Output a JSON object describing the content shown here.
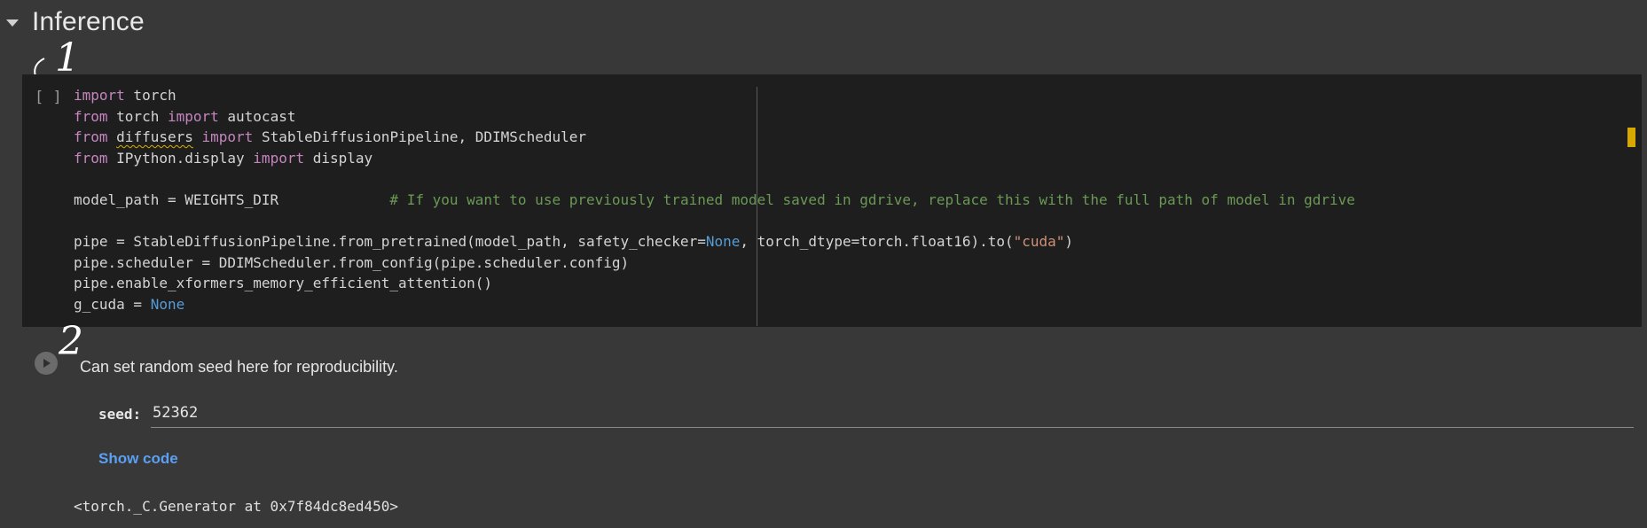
{
  "section": {
    "title": "Inference"
  },
  "code_cell": {
    "run_indicator": "[ ]",
    "lines": [
      [
        {
          "t": "import",
          "c": "kw"
        },
        {
          "t": " torch",
          "c": ""
        }
      ],
      [
        {
          "t": "from",
          "c": "kw"
        },
        {
          "t": " torch ",
          "c": ""
        },
        {
          "t": "import",
          "c": "kw"
        },
        {
          "t": " autocast",
          "c": ""
        }
      ],
      [
        {
          "t": "from",
          "c": "kw"
        },
        {
          "t": " ",
          "c": ""
        },
        {
          "t": "diffusers",
          "c": "squiggle"
        },
        {
          "t": " ",
          "c": ""
        },
        {
          "t": "import",
          "c": "kw"
        },
        {
          "t": " StableDiffusionPipeline, DDIMScheduler",
          "c": ""
        }
      ],
      [
        {
          "t": "from",
          "c": "kw"
        },
        {
          "t": " IPython.display ",
          "c": ""
        },
        {
          "t": "import",
          "c": "kw"
        },
        {
          "t": " display",
          "c": ""
        }
      ],
      [],
      [
        {
          "t": "model_path = WEIGHTS_DIR             ",
          "c": ""
        },
        {
          "t": "# If you want to use previously trained model saved in gdrive, replace this with the full path of model in gdrive",
          "c": "cmt"
        }
      ],
      [],
      [
        {
          "t": "pipe = StableDiffusionPipeline.from_pretrained(model_path, safety_checker=",
          "c": ""
        },
        {
          "t": "None",
          "c": "none"
        },
        {
          "t": ", torch_dtype=torch.float16).to(",
          "c": ""
        },
        {
          "t": "\"cuda\"",
          "c": "str"
        },
        {
          "t": ")",
          "c": ""
        }
      ],
      [
        {
          "t": "pipe.scheduler = DDIMScheduler.from_config(pipe.scheduler.config)",
          "c": ""
        }
      ],
      [
        {
          "t": "pipe.enable_xformers_memory_efficient_attention()",
          "c": ""
        }
      ],
      [
        {
          "t": "g_cuda = ",
          "c": ""
        },
        {
          "t": "None",
          "c": "none"
        }
      ]
    ]
  },
  "annotations": {
    "one": "1",
    "two": "2"
  },
  "form_cell": {
    "description": "Can set random seed here for reproducibility.",
    "seed_label": "seed:",
    "seed_value": "52362",
    "show_code": "Show code",
    "output": "<torch._C.Generator at 0x7f84dc8ed450>"
  },
  "colors": {
    "keyword": "#c586c0",
    "none": "#569cd6",
    "string": "#ce9178",
    "comment": "#6a9955",
    "link": "#5aa0f2"
  }
}
